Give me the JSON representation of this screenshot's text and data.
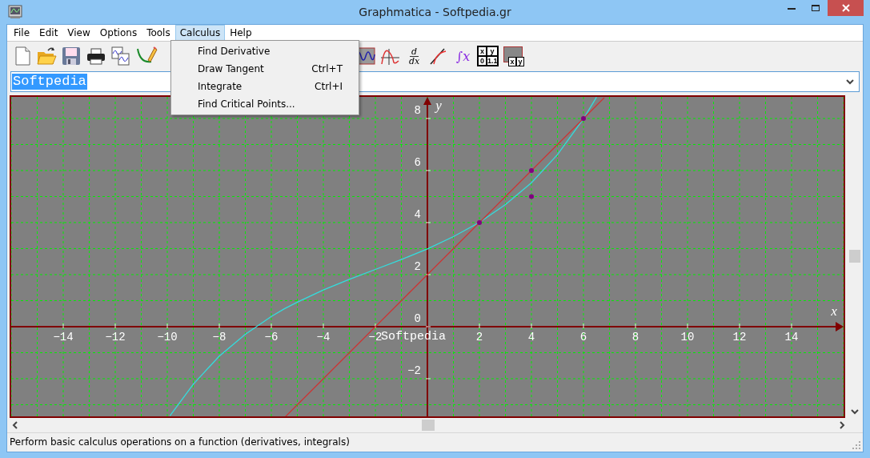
{
  "window": {
    "title": "Graphmatica - Softpedia.gr"
  },
  "menubar": [
    {
      "label": "File",
      "selected": false
    },
    {
      "label": "Edit",
      "selected": false
    },
    {
      "label": "View",
      "selected": false
    },
    {
      "label": "Options",
      "selected": false
    },
    {
      "label": "Tools",
      "selected": false
    },
    {
      "label": "Calculus",
      "selected": true
    },
    {
      "label": "Help",
      "selected": false
    }
  ],
  "menu": {
    "items": [
      {
        "label": "Find Derivative"
      },
      {
        "label": "Draw Tangent",
        "shortcut": "Ctrl+T"
      },
      {
        "label": "Integrate",
        "shortcut": "Ctrl+I"
      },
      {
        "label": "Find Critical Points..."
      }
    ]
  },
  "toolbar": [
    {
      "kind": "new"
    },
    {
      "kind": "open"
    },
    {
      "kind": "save"
    },
    {
      "kind": "print"
    },
    {
      "kind": "copy"
    },
    {
      "kind": "pencil"
    },
    {
      "kind": "gap"
    },
    {
      "kind": "wave"
    },
    {
      "kind": "curve"
    },
    {
      "kind": "derivative",
      "top": "d",
      "bottom": "dx"
    },
    {
      "kind": "tangent"
    },
    {
      "kind": "integral",
      "sign": "∫",
      "var": "x"
    },
    {
      "kind": "table",
      "cells": [
        "x",
        "y",
        "0",
        "1.1"
      ]
    },
    {
      "kind": "plot-table",
      "cells": [
        "x",
        "y"
      ]
    }
  ],
  "equation_field": {
    "value": "Softpedia",
    "selected": true
  },
  "graph": {
    "chart_data": {
      "type": "line",
      "x": [
        -9.9,
        -9,
        -8,
        -7,
        -6,
        -5.5,
        -5,
        -4,
        -3,
        -2,
        -1,
        0,
        1,
        2,
        3,
        4,
        5,
        6,
        6.5,
        6.8
      ],
      "series": [
        {
          "color": "#33dddd",
          "values": [
            -3.43,
            -2.21,
            -1.13,
            -0.29,
            0.39,
            0.69,
            0.94,
            1.41,
            1.82,
            2.2,
            2.58,
            2.99,
            3.46,
            4.01,
            4.69,
            5.53,
            6.61,
            7.99,
            8.82,
            null
          ]
        },
        {
          "color": "#cc3333",
          "values": [
            null,
            null,
            null,
            null,
            null,
            -3.5,
            -3,
            -2,
            -1,
            0,
            1,
            2,
            3,
            4,
            5,
            6,
            7,
            8,
            8.5,
            8.8
          ]
        },
        {
          "type": "scatter",
          "color": "#800080",
          "values": [
            null,
            null,
            null,
            null,
            null,
            null,
            null,
            null,
            null,
            null,
            null,
            null,
            null,
            4,
            null,
            6,
            null,
            8,
            null,
            null
          ]
        },
        {
          "type": "scatter",
          "color": "#800080",
          "values": [
            null,
            null,
            null,
            null,
            null,
            null,
            null,
            null,
            null,
            null,
            null,
            null,
            null,
            null,
            null,
            5,
            null,
            null,
            null,
            null
          ]
        }
      ],
      "xlim": [
        -16,
        16
      ],
      "ylim": [
        -3.57,
        8.83
      ],
      "xlabel": "x",
      "ylabel": "y",
      "grid": true,
      "xticks": [
        -14,
        -12,
        -10,
        -8,
        -6,
        -4,
        -2,
        2,
        4,
        6,
        8,
        10,
        12,
        14
      ],
      "yticks": [
        -2,
        0,
        2,
        4,
        6,
        8
      ],
      "annotations": [
        "Softpedia"
      ]
    }
  },
  "status_bar": {
    "text": "Perform basic calculus operations on a function (derivatives, integrals)"
  }
}
